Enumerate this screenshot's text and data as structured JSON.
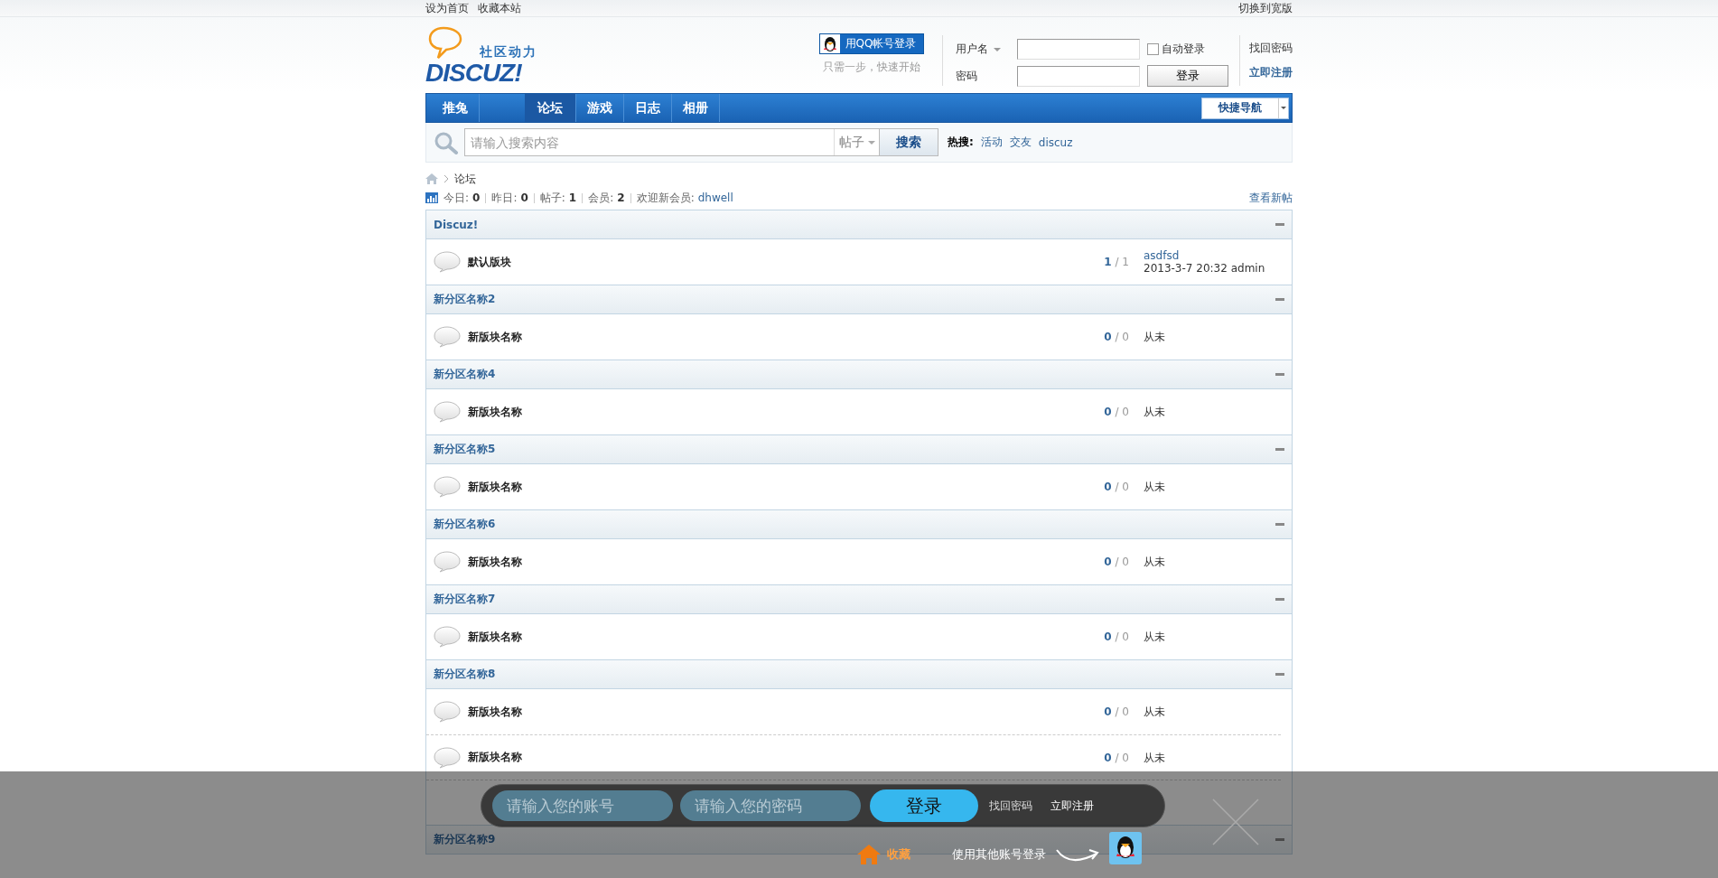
{
  "top_bar": {
    "links": [
      "设为首页",
      "收藏本站"
    ],
    "switch_width": "切换到宽版"
  },
  "header": {
    "logo": {
      "tagline": "社区动力",
      "name": "DISCUZ!"
    },
    "qq_login": {
      "button": "用QQ帐号登录",
      "hint": "只需一步，快速开始"
    },
    "login": {
      "username_label": "用户名",
      "password_label": "密码",
      "auto_login": {
        "label": "自动登录",
        "checked": false
      },
      "submit": "登录",
      "links": [
        "找回密码",
        "立即注册"
      ]
    }
  },
  "nav": {
    "items": [
      {
        "label": "推兔",
        "selected": false
      },
      {
        "label": "论坛",
        "selected": true
      },
      {
        "label": "游戏",
        "selected": false
      },
      {
        "label": "日志",
        "selected": false
      },
      {
        "label": "相册",
        "selected": false
      }
    ],
    "quick_nav": "快捷导航"
  },
  "search": {
    "placeholder": "请输入搜索内容",
    "type": "帖子",
    "button": "搜索",
    "hot_label": "热搜:",
    "hot": [
      "活动",
      "交友",
      "discuz"
    ]
  },
  "breadcrumb": [
    "论坛"
  ],
  "stats": {
    "items": [
      {
        "label": "今日:",
        "value": "0"
      },
      {
        "label": "昨日:",
        "value": "0"
      },
      {
        "label": "帖子:",
        "value": "1"
      },
      {
        "label": "会员:",
        "value": "2"
      }
    ],
    "welcome_label": "欢迎新会员:",
    "new_member": "dhwell",
    "new_posts": "查看新帖"
  },
  "categories": [
    {
      "name": "Discuz!",
      "expanded": true,
      "forums": [
        {
          "name": "默认版块",
          "count": "**1** / 1",
          "last_post": {
            "title": "asdfsd",
            "meta": "2013-3-7 20:32 admin"
          }
        }
      ]
    },
    {
      "name": "新分区名称2",
      "expanded": true,
      "forums": [
        {
          "name": "新版块名称",
          "count": "**0** / 0",
          "last_post": {
            "meta": "从未"
          }
        }
      ]
    },
    {
      "name": "新分区名称4",
      "expanded": true,
      "forums": [
        {
          "name": "新版块名称",
          "count": "**0** / 0",
          "last_post": {
            "meta": "从未"
          }
        }
      ]
    },
    {
      "name": "新分区名称5",
      "expanded": true,
      "forums": [
        {
          "name": "新版块名称",
          "count": "**0** / 0",
          "last_post": {
            "meta": "从未"
          }
        }
      ]
    },
    {
      "name": "新分区名称6",
      "expanded": true,
      "forums": [
        {
          "name": "新版块名称",
          "count": "**0** / 0",
          "last_post": {
            "meta": "从未"
          }
        }
      ]
    },
    {
      "name": "新分区名称7",
      "expanded": true,
      "forums": [
        {
          "name": "新版块名称",
          "count": "**0** / 0",
          "last_post": {
            "meta": "从未"
          }
        }
      ]
    },
    {
      "name": "新分区名称8",
      "expanded": true,
      "forums": [
        {
          "name": "新版块名称",
          "count": "**0** / 0",
          "last_post": {
            "meta": "从未"
          }
        },
        {
          "name": "新版块名称",
          "count": "**0** / 0",
          "last_post": {
            "meta": "从未"
          }
        },
        {
          "kind": "covered"
        }
      ]
    },
    {
      "name": "新分区名称9",
      "expanded": true
    }
  ],
  "login_bar": {
    "account_placeholder": "请输入您的账号",
    "password_placeholder": "请输入您的密码",
    "submit": "登录",
    "links": [
      "找回密码",
      "立即注册"
    ],
    "favorite": "收藏",
    "other_login": "使用其他账号登录"
  }
}
